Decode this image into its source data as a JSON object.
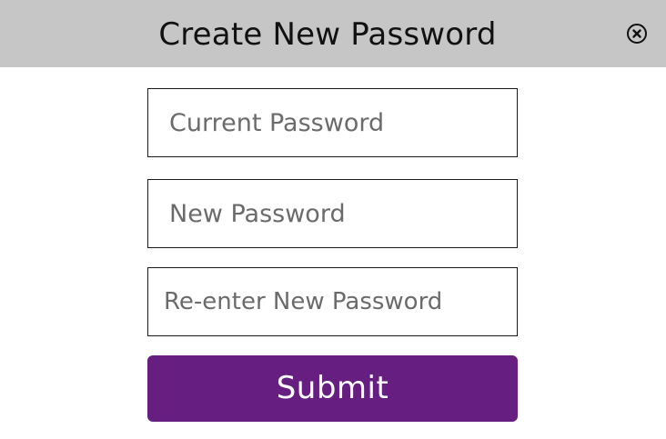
{
  "header": {
    "title": "Create New Password",
    "close_icon": "close-circle-icon"
  },
  "form": {
    "current_password": {
      "value": "",
      "placeholder": "Current Password"
    },
    "new_password": {
      "value": "",
      "placeholder": "New Password"
    },
    "reenter_password": {
      "value": "",
      "placeholder": "Re-enter New Password"
    },
    "submit_label": "Submit"
  },
  "colors": {
    "header_background": "#c6c6c6",
    "submit_background": "#671e81",
    "submit_text": "#ffffff",
    "field_border": "#1a1a1a",
    "placeholder_text": "#6b6b6b"
  }
}
